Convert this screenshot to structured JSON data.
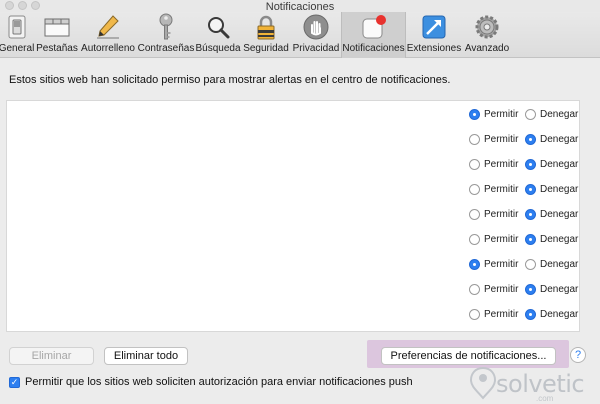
{
  "window": {
    "title": "Notificaciones"
  },
  "toolbar": {
    "items": [
      {
        "label": "General",
        "icon": "general-switch-icon",
        "active": false
      },
      {
        "label": "Pestañas",
        "icon": "tabs-icon",
        "active": false
      },
      {
        "label": "Autorrelleno",
        "icon": "pencil-icon",
        "active": false
      },
      {
        "label": "Contraseñas",
        "icon": "key-icon",
        "active": false
      },
      {
        "label": "Búsqueda",
        "icon": "magnifier-icon",
        "active": false
      },
      {
        "label": "Seguridad",
        "icon": "padlock-icon",
        "active": false
      },
      {
        "label": "Privacidad",
        "icon": "hand-icon",
        "active": false
      },
      {
        "label": "Notificaciones",
        "icon": "notification-badge-icon",
        "active": true
      },
      {
        "label": "Extensiones",
        "icon": "puzzle-arrow-icon",
        "active": false
      },
      {
        "label": "Avanzado",
        "icon": "gear-icon",
        "active": false
      }
    ]
  },
  "main": {
    "description": "Estos sitios web han solicitado permiso para mostrar alertas en el centro de notificaciones.",
    "allow_label": "Permitir",
    "deny_label": "Denegar",
    "sites": [
      {
        "selected": "allow"
      },
      {
        "selected": "deny"
      },
      {
        "selected": "deny"
      },
      {
        "selected": "deny"
      },
      {
        "selected": "deny"
      },
      {
        "selected": "deny"
      },
      {
        "selected": "allow"
      },
      {
        "selected": "deny"
      },
      {
        "selected": "deny"
      }
    ]
  },
  "buttons": {
    "remove": "Eliminar",
    "remove_all": "Eliminar todo",
    "preferences": "Preferencias de notificaciones...",
    "help": "?"
  },
  "push_permission": {
    "label": "Permitir que los sitios web soliciten autorización para enviar notificaciones push",
    "checked": true
  },
  "watermark": {
    "text": "solvetic",
    "sub": ".com"
  },
  "colors": {
    "accent": "#2d7ff0",
    "highlight": "#dcc6de",
    "window_bg": "#ececec"
  }
}
